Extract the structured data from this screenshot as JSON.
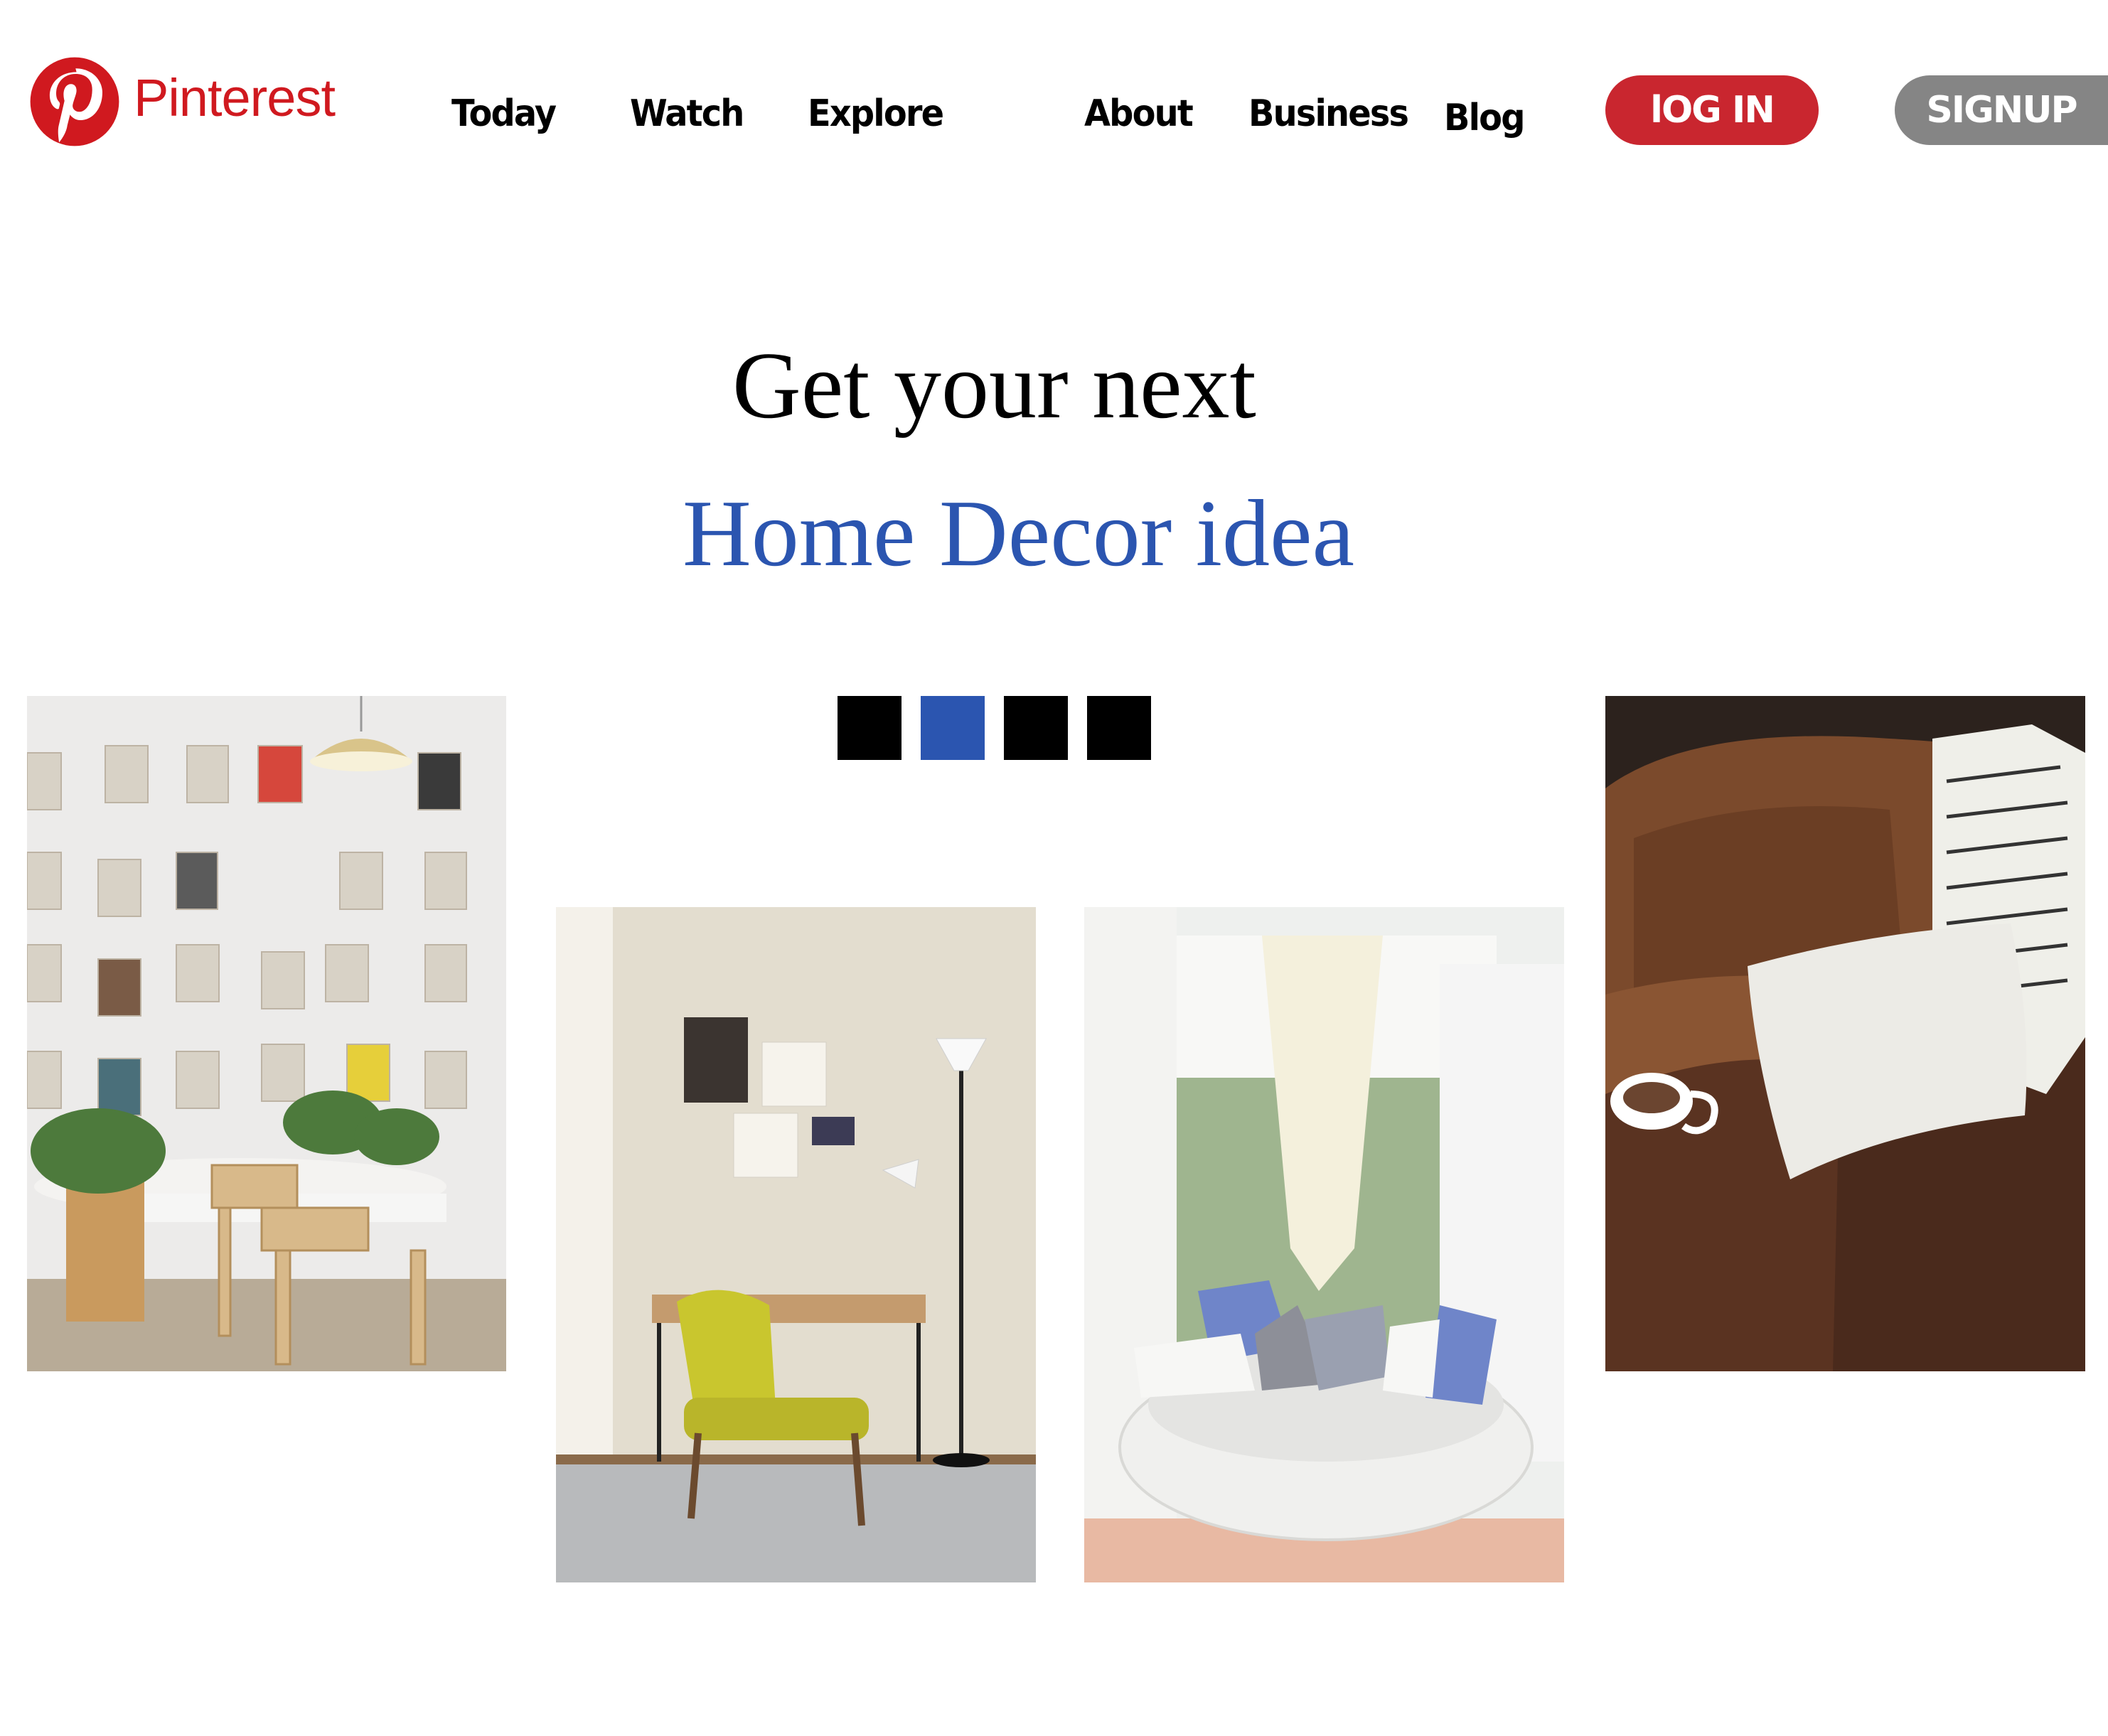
{
  "brand": {
    "name": "Pinterest",
    "color": "#d0191f",
    "logo_icon": "pinterest-p-icon"
  },
  "nav": {
    "items": [
      {
        "label": "Today"
      },
      {
        "label": "Watch"
      },
      {
        "label": "Explore"
      },
      {
        "label": "About"
      },
      {
        "label": "Business"
      },
      {
        "label": "Blog"
      }
    ]
  },
  "auth": {
    "login_label": "lOG IN",
    "login_color": "#c9262f",
    "signup_label": "SIGNUP",
    "signup_color": "#858585"
  },
  "hero": {
    "line1": "Get your next",
    "line2": "Home Decor idea",
    "line2_color": "#2b55b0",
    "indicator_count": 4,
    "active_indicator": 2,
    "indicator_active_color": "#2b55b0",
    "indicator_inactive_color": "#000000"
  },
  "gallery": {
    "photos": [
      {
        "subject": "wall of clipped magazine pages above a white table with wooden chairs and plants"
      },
      {
        "subject": "yellow chair at a wooden desk with a floor lamp and wall posters"
      },
      {
        "subject": "round white wicker lounge seat with blue and white pillows by sheer curtains"
      },
      {
        "subject": "brown leather armchair with white pillow, striped throw and coffee cup"
      }
    ]
  }
}
